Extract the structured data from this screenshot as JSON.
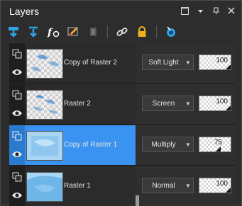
{
  "panel": {
    "title": "Layers",
    "controls": [
      "window-icon",
      "dropdown-icon",
      "pin-icon",
      "close-icon"
    ]
  },
  "toolbar": {
    "tools": [
      {
        "name": "new-layer-icon",
        "color": "#2fa3e6"
      },
      {
        "name": "merge-down-icon",
        "color": "#2fa3e6"
      },
      {
        "name": "effects-fx-icon",
        "color": "#ffffff"
      },
      {
        "name": "brush-icon",
        "color": "#f0a030"
      },
      {
        "name": "mask-icon",
        "color": "#666666"
      },
      {
        "name": "link-icon",
        "color": "#cfd8e0"
      },
      {
        "name": "lock-icon",
        "color": "#f0b020"
      },
      {
        "name": "properties-icon",
        "color": "#2fa3e6"
      }
    ]
  },
  "layers": [
    {
      "name": "Copy of Raster 2",
      "blend": "Soft Light",
      "opacity": "100",
      "selected": false
    },
    {
      "name": "Raster 2",
      "blend": "Screen",
      "opacity": "100",
      "selected": false
    },
    {
      "name": "Copy of Raster 1",
      "blend": "Multiply",
      "opacity": "75",
      "selected": true
    },
    {
      "name": "Raster 1",
      "blend": "Normal",
      "opacity": "100",
      "selected": false
    }
  ],
  "colors": {
    "selected": "#3a93f0",
    "panel_bg": "#2d2d2d"
  }
}
